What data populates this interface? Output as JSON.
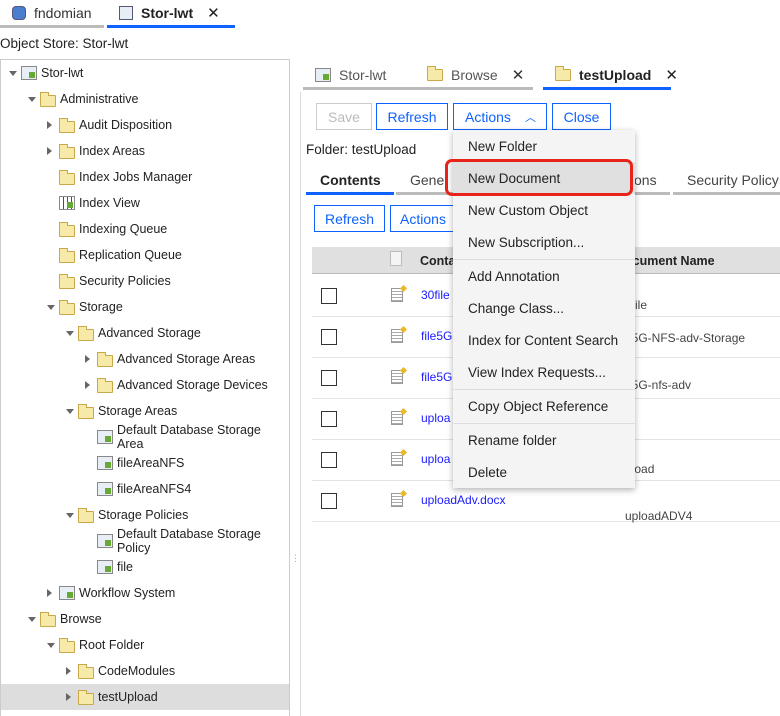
{
  "top_tabs": [
    {
      "label": "fndomian",
      "icon": "domain-icon"
    },
    {
      "label": "Stor-lwt",
      "icon": "object-store-icon",
      "closable": true
    }
  ],
  "object_store_label": "Object Store: Stor-lwt",
  "tree": [
    {
      "label": "Stor-lwt",
      "level": 0,
      "state": "open",
      "icon": "object-store"
    },
    {
      "label": "Administrative",
      "level": 1,
      "state": "open",
      "icon": "folder"
    },
    {
      "label": "Audit Disposition",
      "level": 2,
      "state": "closed",
      "icon": "folder"
    },
    {
      "label": "Index Areas",
      "level": 2,
      "state": "closed",
      "icon": "folder"
    },
    {
      "label": "Index Jobs Manager",
      "level": 2,
      "state": "none",
      "icon": "folder"
    },
    {
      "label": "Index View",
      "level": 2,
      "state": "none",
      "icon": "table"
    },
    {
      "label": "Indexing Queue",
      "level": 2,
      "state": "none",
      "icon": "folder"
    },
    {
      "label": "Replication Queue",
      "level": 2,
      "state": "none",
      "icon": "folder"
    },
    {
      "label": "Security Policies",
      "level": 2,
      "state": "none",
      "icon": "folder"
    },
    {
      "label": "Storage",
      "level": 2,
      "state": "open",
      "icon": "folder"
    },
    {
      "label": "Advanced Storage",
      "level": 3,
      "state": "open",
      "icon": "folder"
    },
    {
      "label": "Advanced Storage Areas",
      "level": 4,
      "state": "closed",
      "icon": "folder"
    },
    {
      "label": "Advanced Storage Devices",
      "level": 4,
      "state": "closed",
      "icon": "folder"
    },
    {
      "label": "Storage Areas",
      "level": 3,
      "state": "open",
      "icon": "folder"
    },
    {
      "label": "Default Database Storage Area",
      "level": 4,
      "state": "none",
      "icon": "storage-area"
    },
    {
      "label": "fileAreaNFS",
      "level": 4,
      "state": "none",
      "icon": "storage-area"
    },
    {
      "label": "fileAreaNFS4",
      "level": 4,
      "state": "none",
      "icon": "storage-area"
    },
    {
      "label": "Storage Policies",
      "level": 3,
      "state": "open",
      "icon": "folder"
    },
    {
      "label": "Default Database Storage Policy",
      "level": 4,
      "state": "none",
      "icon": "storage-policy"
    },
    {
      "label": "file",
      "level": 4,
      "state": "none",
      "icon": "storage-policy"
    },
    {
      "label": "Workflow System",
      "level": 2,
      "state": "closed",
      "icon": "workflow"
    },
    {
      "label": "Browse",
      "level": 1,
      "state": "open",
      "icon": "folder"
    },
    {
      "label": "Root Folder",
      "level": 2,
      "state": "open",
      "icon": "folder"
    },
    {
      "label": "CodeModules",
      "level": 3,
      "state": "closed",
      "icon": "folder"
    },
    {
      "label": "testUpload",
      "level": 3,
      "state": "closed",
      "icon": "folder",
      "selected": true
    }
  ],
  "main_tabs": [
    {
      "label": "Stor-lwt",
      "icon": "object-store"
    },
    {
      "label": "Browse",
      "icon": "folder",
      "closable": true
    },
    {
      "label": "testUpload",
      "icon": "folder",
      "closable": true,
      "active": true
    }
  ],
  "toolbar": {
    "save": "Save",
    "refresh": "Refresh",
    "actions": "Actions",
    "close": "Close"
  },
  "folder_label": "Folder: testUpload",
  "sub_tabs": [
    "Contents",
    "Gene",
    "ons",
    "Security Policy"
  ],
  "contents_toolbar": {
    "refresh": "Refresh",
    "actions": "Actions"
  },
  "table": {
    "headers": [
      "Conta",
      "ocument Name"
    ],
    "rows": [
      {
        "content": "30file",
        "doc": "0file"
      },
      {
        "content": "file5G",
        "doc": "e5G-NFS-adv-Storage"
      },
      {
        "content": "file5G",
        "doc": "e5G-nfs-adv"
      },
      {
        "content": "uploa",
        "doc": ""
      },
      {
        "content": "uploa",
        "doc": "pload"
      },
      {
        "content": "uploadAdv.docx",
        "doc": "uploadADV4"
      }
    ]
  },
  "actions_menu": [
    [
      "New Folder",
      "New Document",
      "New Custom Object",
      "New Subscription..."
    ],
    [
      "Add Annotation",
      "Change Class...",
      "Index for Content Search",
      "View Index Requests..."
    ],
    [
      "Copy Object Reference"
    ],
    [
      "Rename folder",
      "Delete"
    ]
  ],
  "highlighted_item": "New Document",
  "colors": {
    "accent": "#0f62fe",
    "highlight": "#e8231a",
    "link": "#1a1aff"
  }
}
